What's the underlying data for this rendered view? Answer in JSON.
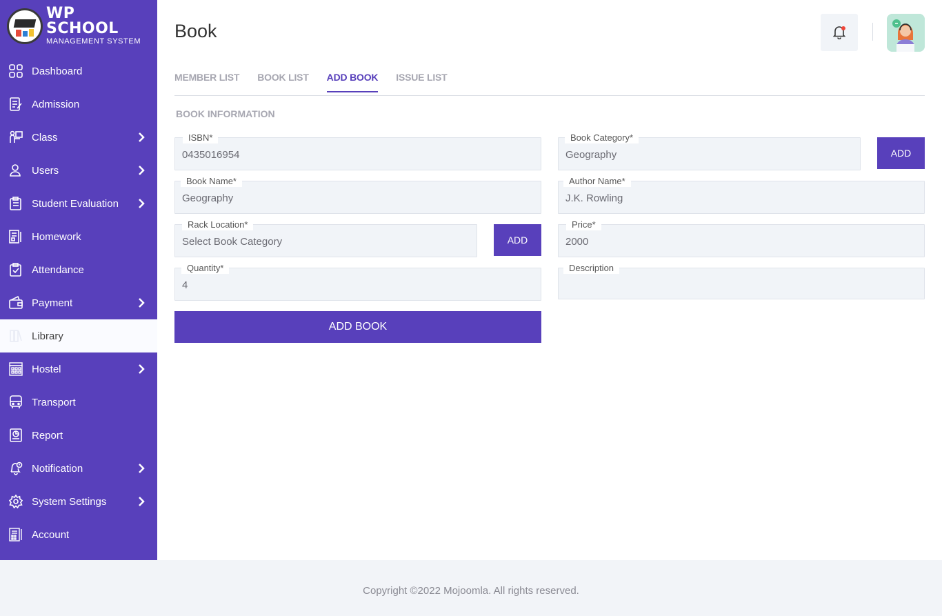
{
  "brand": {
    "title": "WP SCHOOL",
    "subtitle": "MANAGEMENT SYSTEM"
  },
  "sidebar": {
    "items": [
      {
        "label": "Dashboard",
        "icon": "dashboard-icon",
        "has_submenu": false
      },
      {
        "label": "Admission",
        "icon": "admission-icon",
        "has_submenu": false
      },
      {
        "label": "Class",
        "icon": "class-icon",
        "has_submenu": true
      },
      {
        "label": "Users",
        "icon": "user-icon",
        "has_submenu": true
      },
      {
        "label": "Student Evaluation",
        "icon": "clipboard-icon",
        "has_submenu": true
      },
      {
        "label": "Homework",
        "icon": "homework-icon",
        "has_submenu": false
      },
      {
        "label": "Attendance",
        "icon": "attendance-icon",
        "has_submenu": false
      },
      {
        "label": "Payment",
        "icon": "wallet-icon",
        "has_submenu": true
      },
      {
        "label": "Library",
        "icon": "library-icon",
        "has_submenu": false,
        "active": true
      },
      {
        "label": "Hostel",
        "icon": "hostel-icon",
        "has_submenu": true
      },
      {
        "label": "Transport",
        "icon": "bus-icon",
        "has_submenu": false
      },
      {
        "label": "Report",
        "icon": "report-icon",
        "has_submenu": false
      },
      {
        "label": "Notification",
        "icon": "notification-icon",
        "has_submenu": true
      },
      {
        "label": "System Settings",
        "icon": "gear-icon",
        "has_submenu": true
      },
      {
        "label": "Account",
        "icon": "account-icon",
        "has_submenu": false
      }
    ]
  },
  "header": {
    "title": "Book"
  },
  "tabs": [
    {
      "label": "MEMBER LIST",
      "active": false
    },
    {
      "label": "BOOK LIST",
      "active": false
    },
    {
      "label": "ADD BOOK",
      "active": true
    },
    {
      "label": "ISSUE LIST",
      "active": false
    }
  ],
  "form": {
    "section_title": "BOOK INFORMATION",
    "isbn": {
      "label": "ISBN*",
      "value": "0435016954"
    },
    "book_category": {
      "label": "Book Category*",
      "value": "Geography"
    },
    "book_name": {
      "label": "Book Name*",
      "value": "Geography"
    },
    "author_name": {
      "label": "Author Name*",
      "value": "J.K. Rowling"
    },
    "rack_location": {
      "label": "Rack Location*",
      "value": "Select Book Category"
    },
    "price": {
      "label": "Price*",
      "value": "2000"
    },
    "quantity": {
      "label": "Quantity*",
      "value": "4"
    },
    "description": {
      "label": "Description",
      "value": ""
    },
    "add_label": "ADD",
    "submit_label": "ADD BOOK"
  },
  "footer": {
    "copyright": "Copyright ©2022 Mojoomla. All rights reserved."
  },
  "colors": {
    "accent": "#5840bb",
    "field_bg": "#f1f4f8",
    "footer_bg": "#f2f4f8"
  }
}
